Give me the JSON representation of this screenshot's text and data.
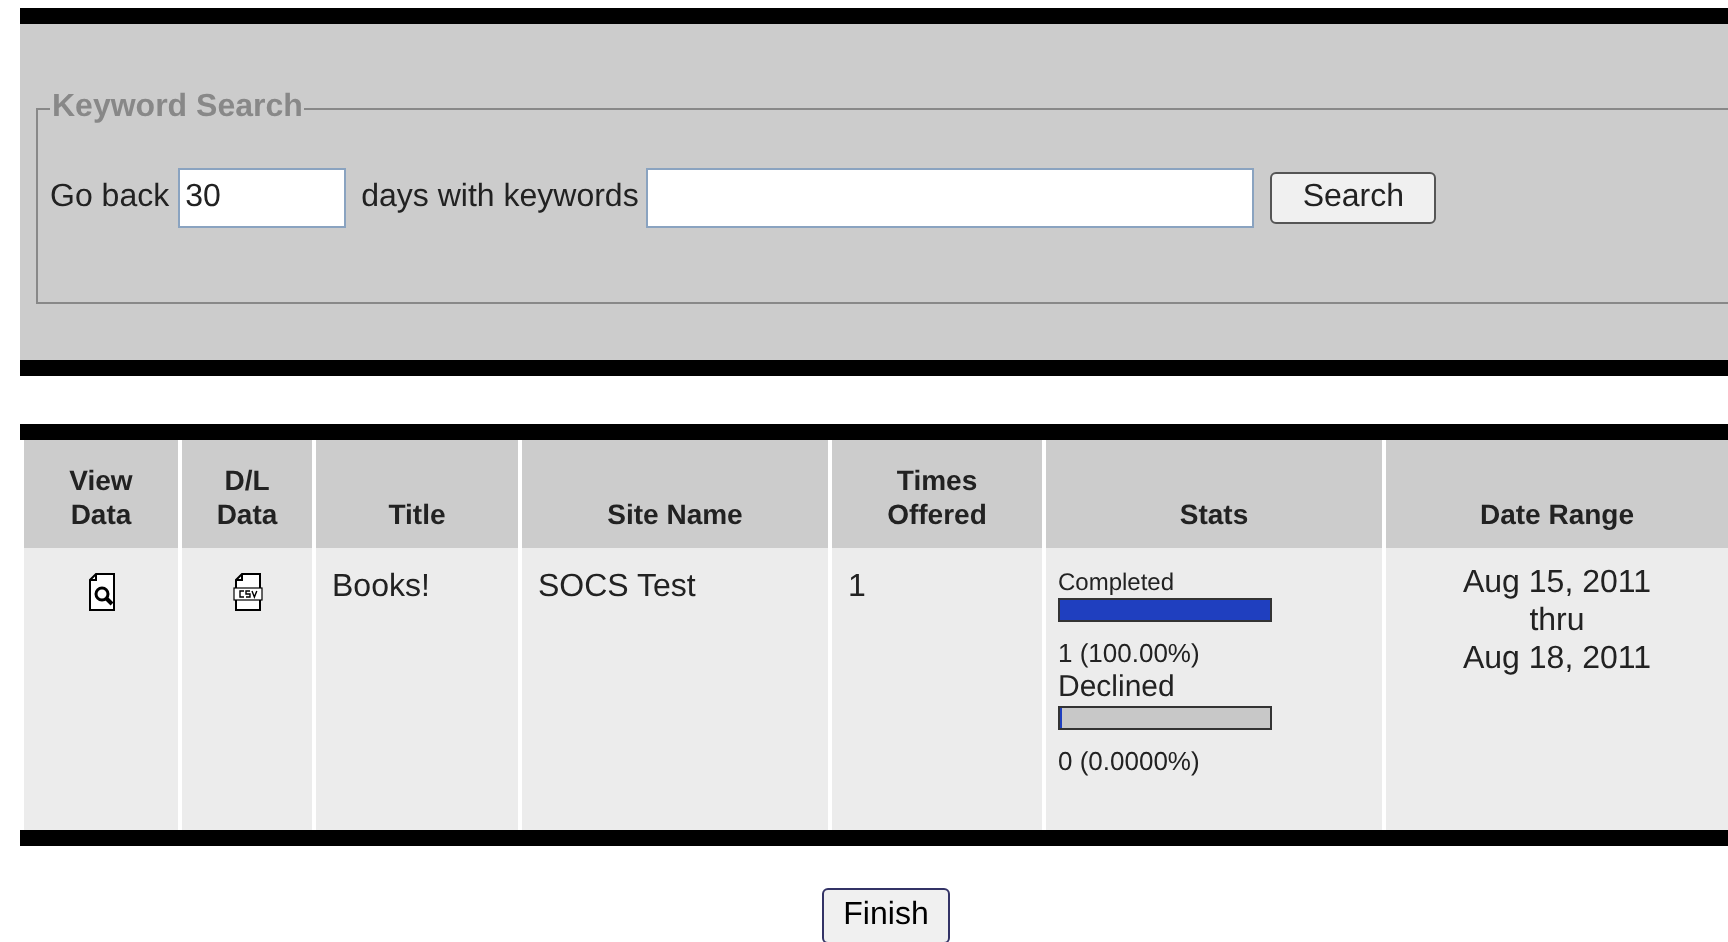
{
  "search": {
    "legend": "Keyword Search",
    "label_before": "Go back",
    "days_value": "30",
    "label_after": "days with keywords",
    "button": "Search"
  },
  "table": {
    "columns": [
      "View Data",
      "D/L Data",
      "Title",
      "Site Name",
      "Times Offered",
      "Stats",
      "Date Range"
    ],
    "rows": [
      {
        "title": "Books!",
        "site_name": "SOCS Test",
        "times_offered": "1",
        "stats": [
          {
            "label": "Completed",
            "level": 1,
            "reading": "1 (100.00%)"
          },
          {
            "label": "Declined",
            "level": 0,
            "reading": "0 (0.0000%)"
          }
        ],
        "date_range": [
          "Aug 15, 2011",
          "thru",
          "Aug 18, 2011"
        ]
      }
    ]
  },
  "finish_button": "Finish"
}
